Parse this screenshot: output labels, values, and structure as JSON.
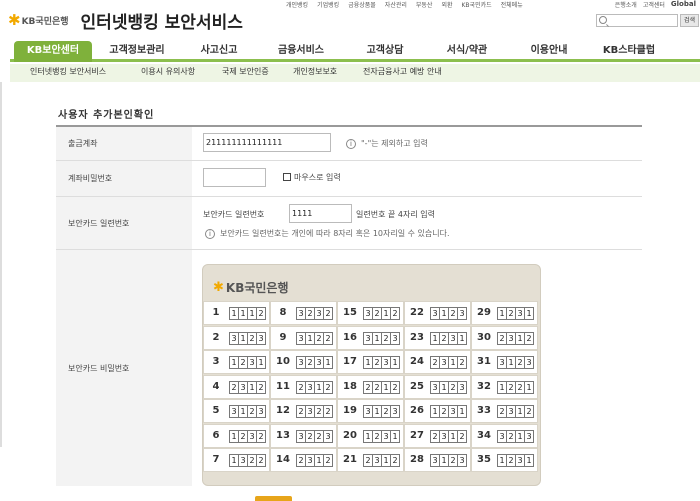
{
  "header": {
    "logo_text": "KB국민은행",
    "site_title": "인터넷뱅킹 보안서비스",
    "top_links": [
      "개인뱅킹",
      "기업뱅킹",
      "금융상품몰",
      "자산관리",
      "부동산",
      "외환",
      "KB국민카드",
      "전체메뉴"
    ],
    "util_links": [
      "은행소개",
      "고객센터",
      "Global"
    ],
    "search_button": "검색"
  },
  "nav": {
    "items": [
      "KB보안센터",
      "고객정보관리",
      "사고신고",
      "금융서비스",
      "고객상담",
      "서식/약관",
      "이용안내",
      "KB스타클럽"
    ],
    "active": "KB보안센터",
    "sub_items": [
      "인터넷뱅킹 보안서비스",
      "이용시 유의사항",
      "국제 보안인증",
      "개인정보보호",
      "전자금융사고 예방 안내"
    ]
  },
  "form": {
    "title": "사용자 추가본인확인",
    "withdraw_account_label": "출금계좌",
    "withdraw_account_value": "211111111111111",
    "withdraw_account_note": "\"-\"는 제외하고 입력",
    "account_password_label": "계좌비밀번호",
    "mouse_input_label": "마우스로 입력",
    "card_serial_label": "보안카드 일련번호",
    "card_serial_prefix": "보안카드 일련번호",
    "card_serial_value": "1111",
    "card_serial_suffix": "일련번호 끝 4자리 입력",
    "card_serial_note": "보안카드 일련번호는 개인에 따라 8자리 혹은 10자리일 수 있습니다.",
    "card_password_label": "보안카드 비밀번호"
  },
  "security_card": {
    "logo_text": "KB국민은행",
    "cells": [
      {
        "n": "1",
        "code": "1112"
      },
      {
        "n": "8",
        "code": "3232"
      },
      {
        "n": "15",
        "code": "3212"
      },
      {
        "n": "22",
        "code": "3123"
      },
      {
        "n": "29",
        "code": "1231"
      },
      {
        "n": "2",
        "code": "3123"
      },
      {
        "n": "9",
        "code": "3122"
      },
      {
        "n": "16",
        "code": "3123"
      },
      {
        "n": "23",
        "code": "1231"
      },
      {
        "n": "30",
        "code": "2312"
      },
      {
        "n": "3",
        "code": "1231"
      },
      {
        "n": "10",
        "code": "3231"
      },
      {
        "n": "17",
        "code": "1231"
      },
      {
        "n": "24",
        "code": "2312"
      },
      {
        "n": "31",
        "code": "3123"
      },
      {
        "n": "4",
        "code": "2312"
      },
      {
        "n": "11",
        "code": "2312"
      },
      {
        "n": "18",
        "code": "2212"
      },
      {
        "n": "25",
        "code": "3123"
      },
      {
        "n": "32",
        "code": "1221"
      },
      {
        "n": "5",
        "code": "3123"
      },
      {
        "n": "12",
        "code": "2322"
      },
      {
        "n": "19",
        "code": "3123"
      },
      {
        "n": "26",
        "code": "1231"
      },
      {
        "n": "33",
        "code": "2312"
      },
      {
        "n": "6",
        "code": "1232"
      },
      {
        "n": "13",
        "code": "3223"
      },
      {
        "n": "20",
        "code": "1231"
      },
      {
        "n": "27",
        "code": "2312"
      },
      {
        "n": "34",
        "code": "3213"
      },
      {
        "n": "7",
        "code": "1322"
      },
      {
        "n": "14",
        "code": "2312"
      },
      {
        "n": "21",
        "code": "2312"
      },
      {
        "n": "28",
        "code": "3123"
      },
      {
        "n": "35",
        "code": "1231"
      }
    ]
  },
  "colors": {
    "nav_active": "#7fb13b",
    "nav_underline": "#8cbf4e",
    "sub_nav_bg": "#eef5e4",
    "card_bg": "#e4dfd3",
    "kb_star": "#f2a900"
  }
}
